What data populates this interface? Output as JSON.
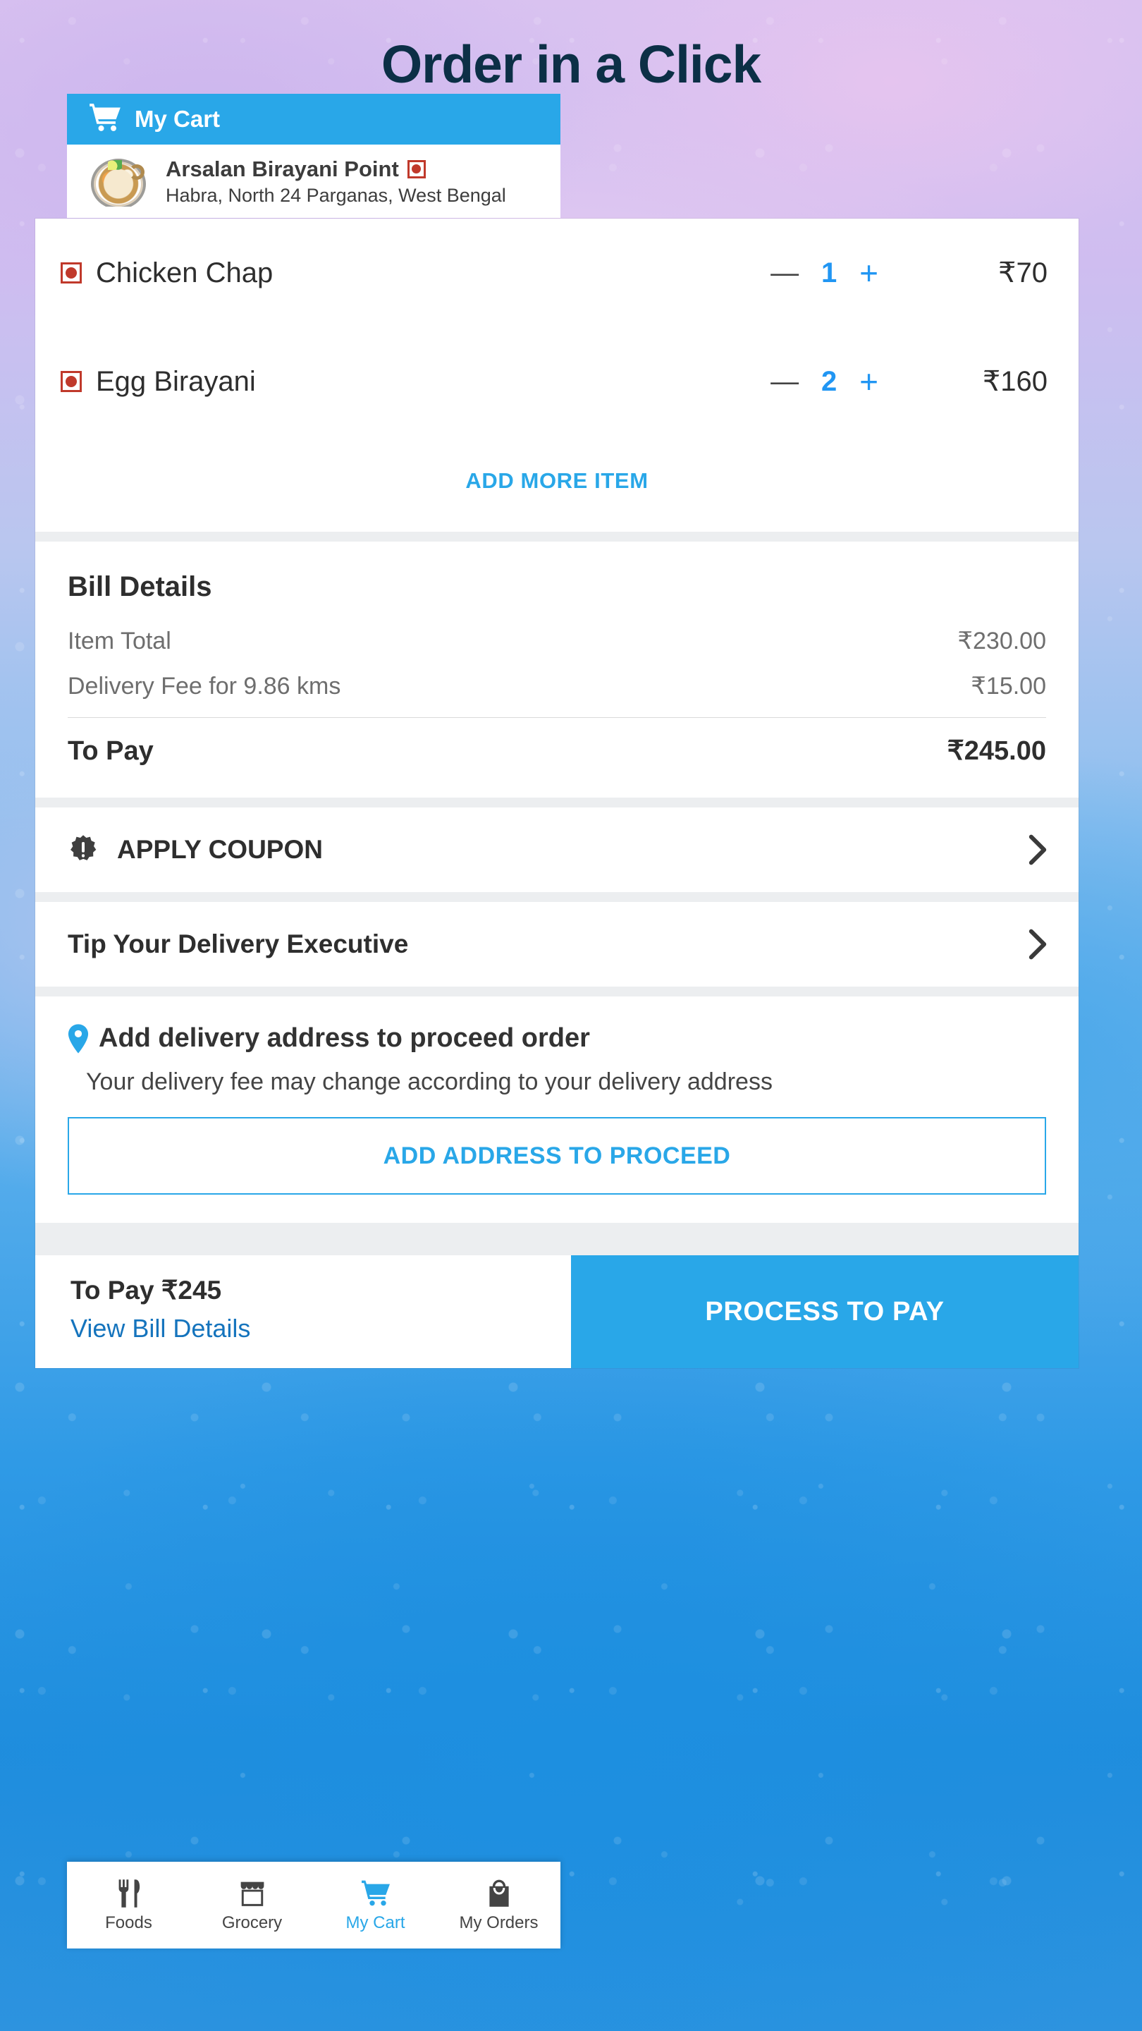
{
  "page": {
    "title": "Order in a Click",
    "title_color": "#0c2f46",
    "accent_color": "#29a7e8"
  },
  "cart_header": {
    "icon": "shopping-cart-icon",
    "label": "My Cart"
  },
  "restaurant": {
    "thumbnail": "biryani-bowl-image",
    "name": "Arsalan Birayani Point",
    "diet_indicator": "non-veg-indicator",
    "address": "Habra, North 24 Parganas, West Bengal"
  },
  "cart_items": [
    {
      "diet_indicator": "non-veg-indicator",
      "name": "Chicken Chap",
      "decrement_label": "—",
      "quantity": "1",
      "increment_label": "+",
      "price": "₹70"
    },
    {
      "diet_indicator": "non-veg-indicator",
      "name": "Egg Birayani",
      "decrement_label": "—",
      "quantity": "2",
      "increment_label": "+",
      "price": "₹160"
    }
  ],
  "add_more_label": "ADD MORE ITEM",
  "bill": {
    "title": "Bill Details",
    "lines": [
      {
        "label": "Item Total",
        "value": "₹230.00"
      },
      {
        "label": "Delivery Fee for 9.86 kms",
        "value": "₹15.00"
      }
    ],
    "total_label": "To Pay",
    "total_value": "₹245.00"
  },
  "options": [
    {
      "icon": "coupon-badge-icon",
      "label": "APPLY COUPON",
      "chevron": "chevron-right-icon"
    },
    {
      "icon": "none",
      "label": "Tip Your Delivery Executive",
      "chevron": "chevron-right-icon"
    }
  ],
  "address_section": {
    "icon": "location-pin-icon",
    "title": "Add delivery address to proceed order",
    "subtitle": "Your delivery fee may change according to your delivery address",
    "button_label": "ADD ADDRESS TO PROCEED"
  },
  "pay_bar": {
    "amount_label": "To Pay ₹245",
    "view_bill_label": "View Bill Details",
    "process_label": "PROCESS TO PAY"
  },
  "bottom_nav": {
    "items": [
      {
        "icon": "fork-knife-icon",
        "label": "Foods",
        "active": false
      },
      {
        "icon": "store-icon",
        "label": "Grocery",
        "active": false
      },
      {
        "icon": "shopping-cart-icon",
        "label": "My Cart",
        "active": true
      },
      {
        "icon": "shopping-bag-icon",
        "label": "My Orders",
        "active": false
      }
    ]
  }
}
